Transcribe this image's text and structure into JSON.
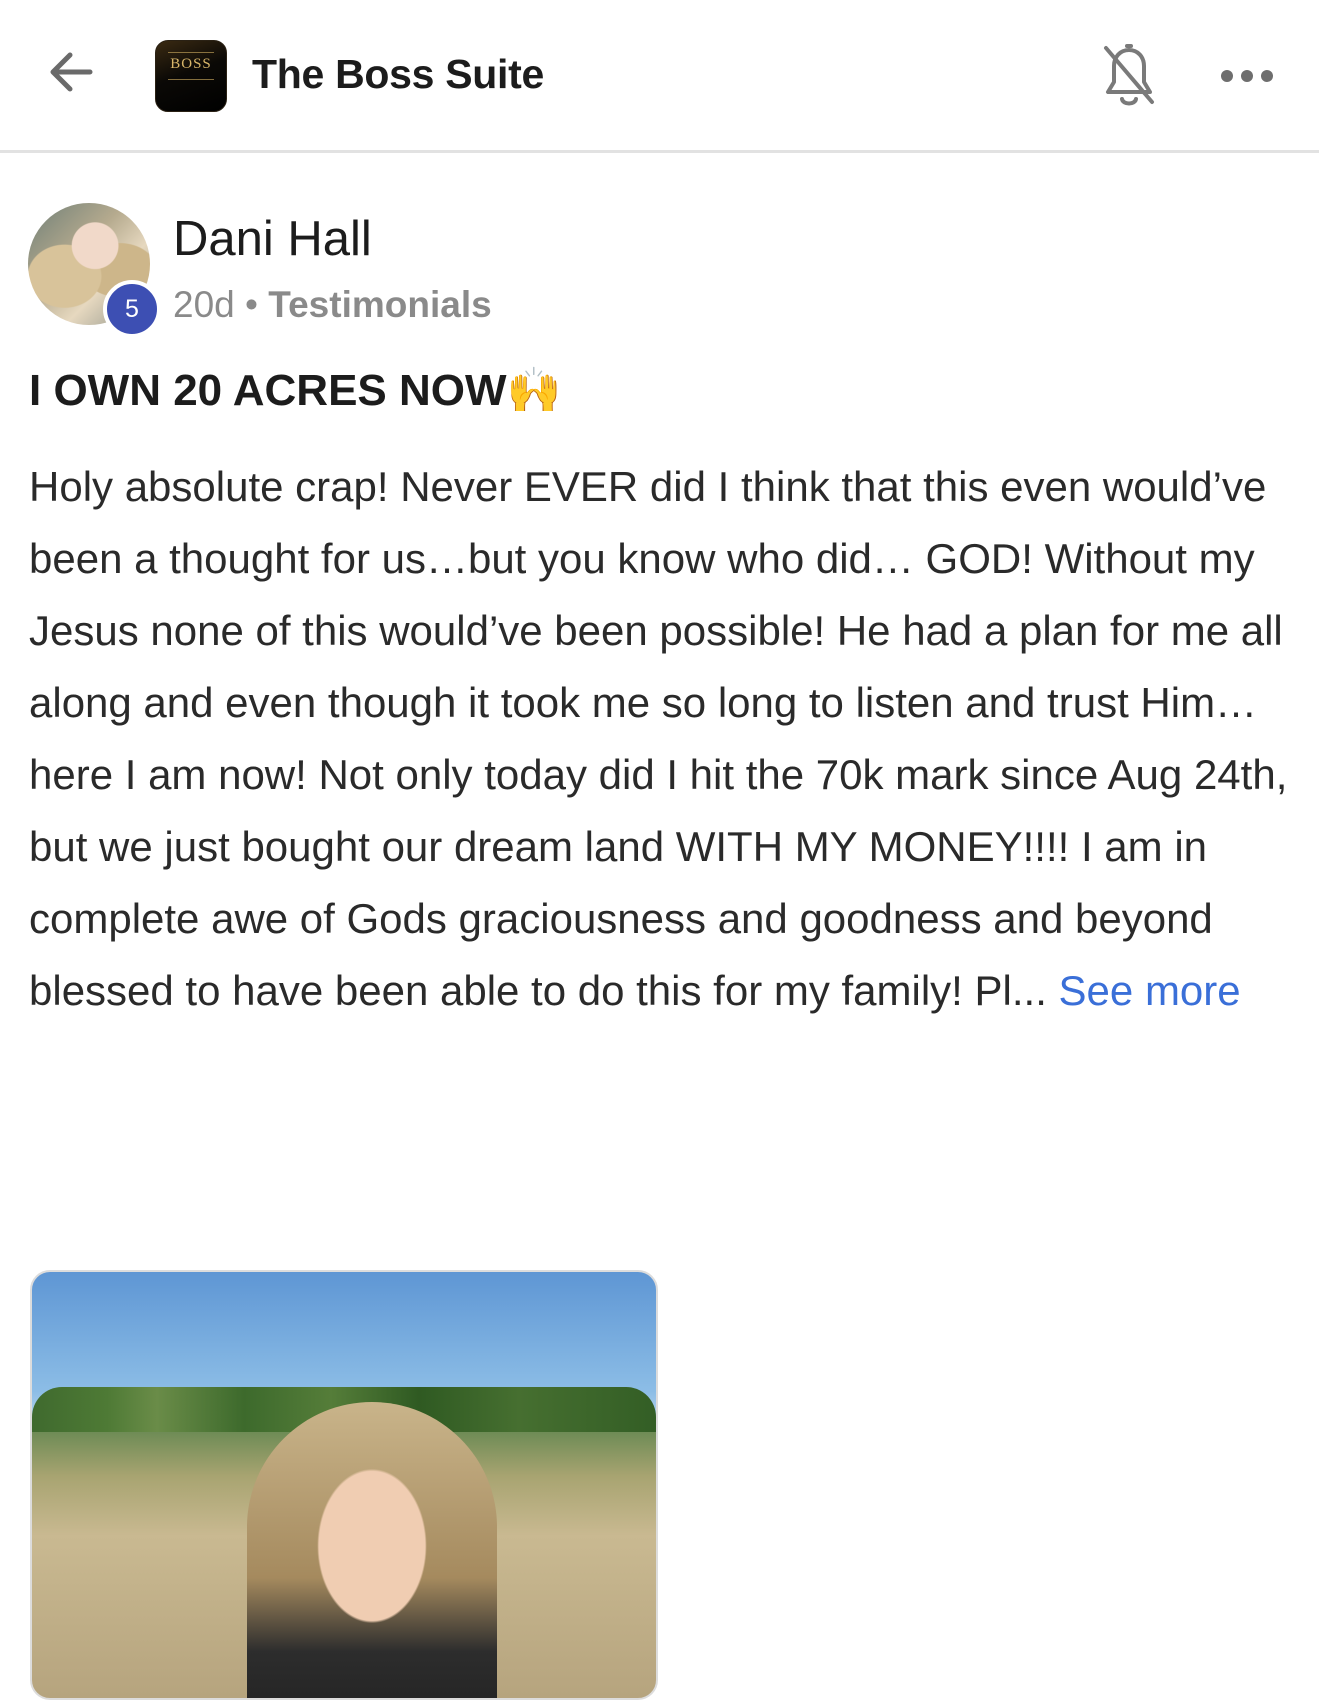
{
  "header": {
    "title": "The Boss Suite",
    "logo_text": "BOSS"
  },
  "post": {
    "author_name": "Dani Hall",
    "level": "5",
    "age": "20d",
    "separator": " • ",
    "category": "Testimonials",
    "title": "I OWN 20 ACRES NOW🙌",
    "body": "Holy absolute crap! Never EVER did I think that this even would’ve been a thought for us…but you know who did… GOD! Without my Jesus none of this would’ve been possible! He had a plan for me all along and even though it took me so long to listen and trust Him…here I am now! Not only today did I hit the 70k mark since Aug 24th, but we just bought our dream land WITH MY MONEY!!!! I am in complete awe of Gods graciousness and goodness and beyond blessed to have been able to do this for my family! Pl... ",
    "see_more": "See more"
  },
  "icons": {
    "back": "arrow-left-icon",
    "notifications": "bell-off-icon",
    "more": "more-horizontal-icon"
  },
  "colors": {
    "link": "#3a6fd8",
    "badge": "#3d4fb3",
    "text": "#1c1c1c",
    "meta": "#8a8a8a"
  }
}
